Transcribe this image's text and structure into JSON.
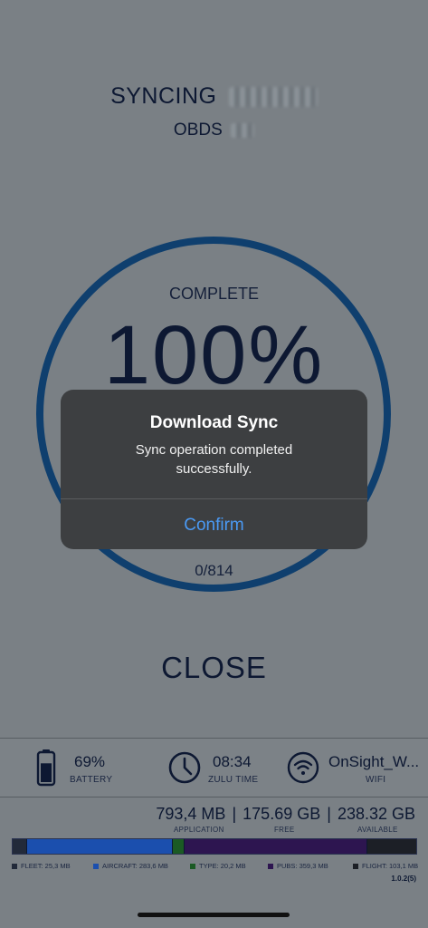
{
  "header": {
    "syncing_label": "SYNCING",
    "obds_label": "OBDS"
  },
  "progress": {
    "status_label": "COMPLETE",
    "percent_text": "100%",
    "percent_value": 100,
    "counter_text": "0/814"
  },
  "dialog": {
    "title": "Download Sync",
    "message": "Sync operation completed successfully.",
    "confirm_label": "Confirm"
  },
  "close_label": "CLOSE",
  "status_bar": {
    "battery": {
      "value": "69%",
      "label": "BATTERY",
      "level": 0.69,
      "icon": "battery-icon"
    },
    "time": {
      "value": "08:34",
      "label": "ZULU TIME",
      "icon": "clock-icon"
    },
    "wifi": {
      "value": "OnSight_W...",
      "label": "WIFI",
      "icon": "wifi-icon"
    }
  },
  "storage": {
    "application": "793,4 MB",
    "free": "175.69 GB",
    "available": "238.32 GB",
    "application_label": "APPLICATION",
    "free_label": "FREE",
    "available_label": "AVAILABLE",
    "separator": "|",
    "segments": [
      {
        "name": "FLEET",
        "legend": "FLEET: 25,3 MB",
        "color": "#222a3a",
        "share": 0.035
      },
      {
        "name": "AIRCRAFT",
        "legend": "AIRCRAFT: 283,6 MB",
        "color": "#1b4fae",
        "share": 0.36
      },
      {
        "name": "TYPE",
        "legend": "TYPE: 20,2 MB",
        "color": "#1b5a24",
        "share": 0.028
      },
      {
        "name": "PUBS",
        "legend": "PUBS: 359,3 MB",
        "color": "#2d1550",
        "share": 0.455
      },
      {
        "name": "FLIGHT",
        "legend": "FLIGHT: 103,1 MB",
        "color": "#1c1f26",
        "share": 0.122
      }
    ]
  },
  "version": "1.0.2(5)",
  "colors": {
    "accent": "#4a9af5",
    "ring": "#0f3f6e",
    "background": "#7a8085"
  }
}
